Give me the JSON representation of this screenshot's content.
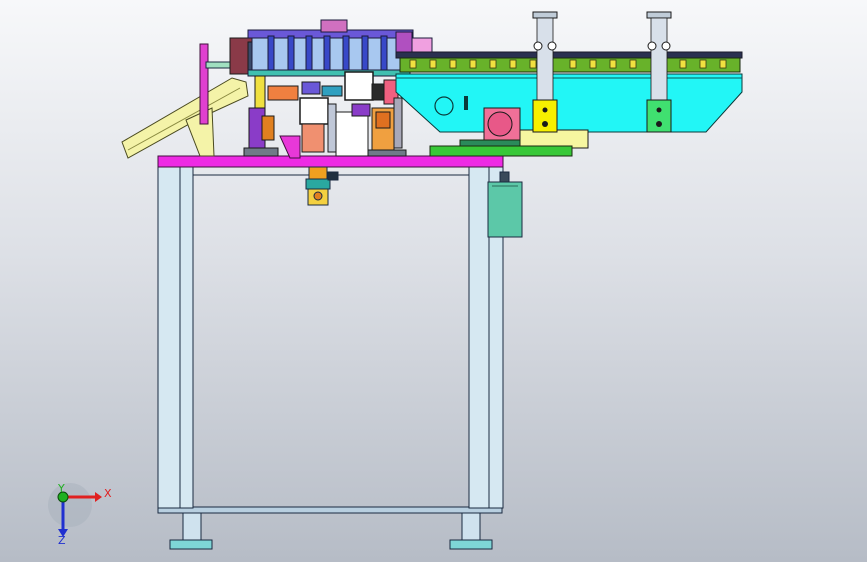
{
  "triad": {
    "x_label": "X",
    "y_label": "Y",
    "z_label": "Z",
    "x_color": "#e02020",
    "y_color": "#20b020",
    "z_color": "#2030d0"
  },
  "colors": {
    "frame": "#cfe2ee",
    "top_plate": "#ee2ae4",
    "hopper": "#f4f3a8",
    "conveyor_body": "#22f6f6",
    "conveyor_rail": "#68b22a",
    "motor": "#f07098",
    "feeder_block": "#6a58d8",
    "control_box": "#5cc8a8",
    "yellow_bracket": "#f6f000",
    "green_bracket": "#40e070"
  }
}
